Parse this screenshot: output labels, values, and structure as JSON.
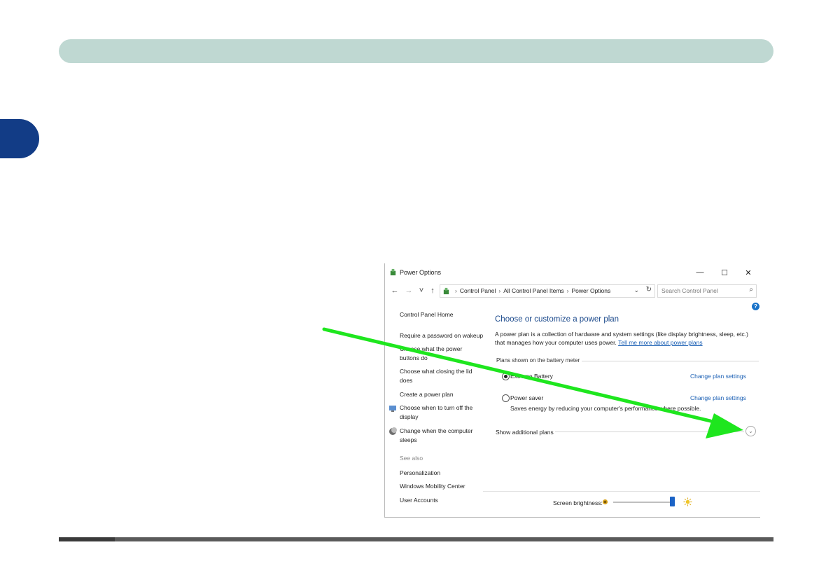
{
  "window": {
    "title": "Power Options",
    "controls": {
      "minimize": "—",
      "maximize": "☐",
      "close": "✕"
    }
  },
  "address": {
    "back": "←",
    "forward": "→",
    "recent": "˅",
    "up": "↑",
    "crumbs": [
      "Control Panel",
      "All Control Panel Items",
      "Power Options"
    ],
    "separator": "›",
    "dropdown": "⌄",
    "refresh": "↻",
    "search_placeholder": "Search Control Panel",
    "search_icon": "⌕"
  },
  "sidebar": {
    "home": "Control Panel Home",
    "links": [
      "Require a password on wakeup",
      "Choose what the power buttons do",
      "Choose what closing the lid does",
      "Create a power plan",
      "Choose when to turn off the display",
      "Change when the computer sleeps"
    ],
    "see_also_label": "See also",
    "see_also": [
      "Personalization",
      "Windows Mobility Center",
      "User Accounts"
    ]
  },
  "main": {
    "help": "?",
    "heading": "Choose or customize a power plan",
    "description": "A power plan is a collection of hardware and system settings (like display brightness, sleep, etc.) that manages how your computer uses power.",
    "description_link": "Tell me more about power plans",
    "group_label": "Plans shown on the battery meter",
    "plans": [
      {
        "name": "Extreme Battery",
        "selected": true,
        "link": "Change plan settings"
      },
      {
        "name": "Power saver",
        "selected": false,
        "link": "Change plan settings",
        "description": "Saves energy by reducing your computer's performance where possible."
      }
    ],
    "additional_plans": "Show additional plans",
    "expand_icon": "⌄"
  },
  "brightness": {
    "label": "Screen brightness:",
    "level_percent": 95
  },
  "annotation": {
    "arrow_color": "#1ee61e"
  },
  "page": {
    "header_color": "#bfd8d2",
    "tab_color": "#123c86"
  }
}
